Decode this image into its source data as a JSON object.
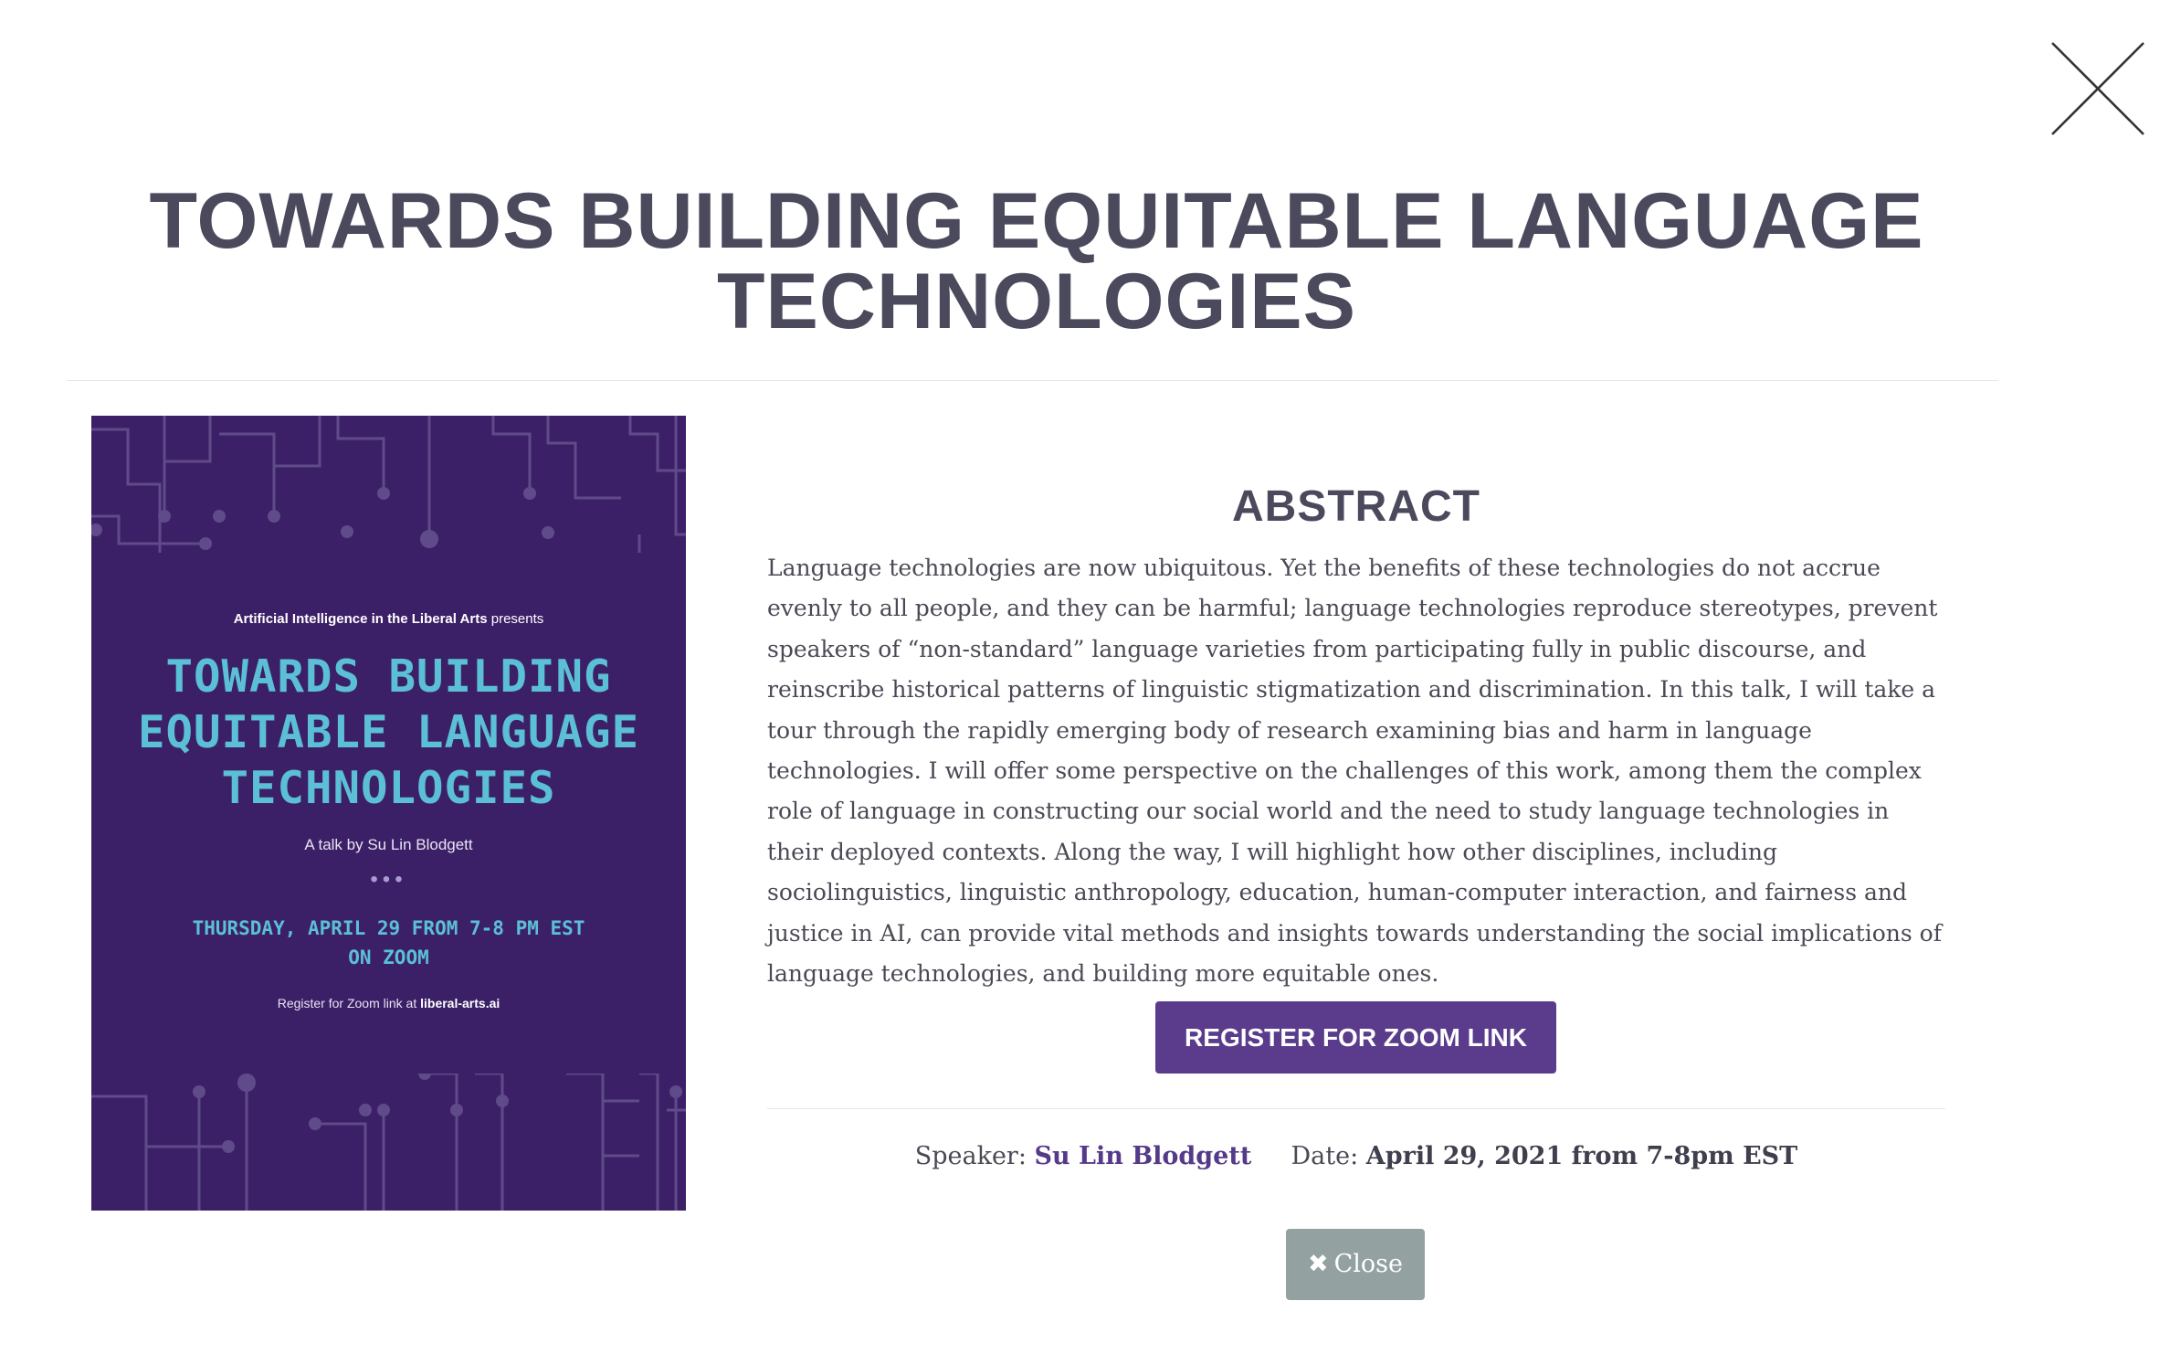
{
  "modal": {
    "title": "TOWARDS BUILDING EQUITABLE LANGUAGE TECHNOLOGIES",
    "close_icon": "close-x-icon"
  },
  "poster": {
    "presenter_bold": "Artificial Intelligence in the Liberal Arts",
    "presenter_suffix": " presents",
    "title": "TOWARDS BUILDING EQUITABLE LANGUAGE TECHNOLOGIES",
    "byline": "A talk by Su Lin Blodgett",
    "dots": "•••",
    "when_line1": "THURSDAY, APRIL 29 FROM 7-8 PM EST",
    "when_line2": "ON ZOOM",
    "register_prefix": "Register for Zoom link at ",
    "register_site": "liberal-arts.ai",
    "colors": {
      "background": "#3c2067",
      "accent": "#5bbfd6",
      "circuit": "#5f4a8a"
    }
  },
  "abstract": {
    "heading": "ABSTRACT",
    "body": "Language technologies are now ubiquitous. Yet the benefits of these technologies do not accrue evenly to all people, and they can be harmful; language technologies reproduce stereotypes, prevent speakers of “non-standard” language varieties from participating fully in public discourse, and reinscribe historical patterns of linguistic stigmatization and discrimination. In this talk, I will take a tour through the rapidly emerging body of research examining bias and harm in language technologies. I will offer some perspective on the challenges of this work, among them the complex role of language in constructing our social world and the need to study language technologies in their deployed contexts. Along the way, I will highlight how other disciplines, including sociolinguistics, linguistic anthropology, education, human-computer interaction, and fairness and justice in AI, can provide vital methods and insights towards understanding the social implications of language technologies, and building more equitable ones."
  },
  "register": {
    "label": "REGISTER FOR ZOOM LINK",
    "color": "#5b3c8c"
  },
  "meta": {
    "speaker_label": "Speaker:",
    "speaker_name": "Su Lin Blodgett",
    "date_label": "Date:",
    "date_value": "April 29, 2021 from 7-8pm EST"
  },
  "close_button": {
    "icon": "times-icon",
    "glyph": "✖",
    "label": "Close",
    "color": "#93a1a1"
  }
}
